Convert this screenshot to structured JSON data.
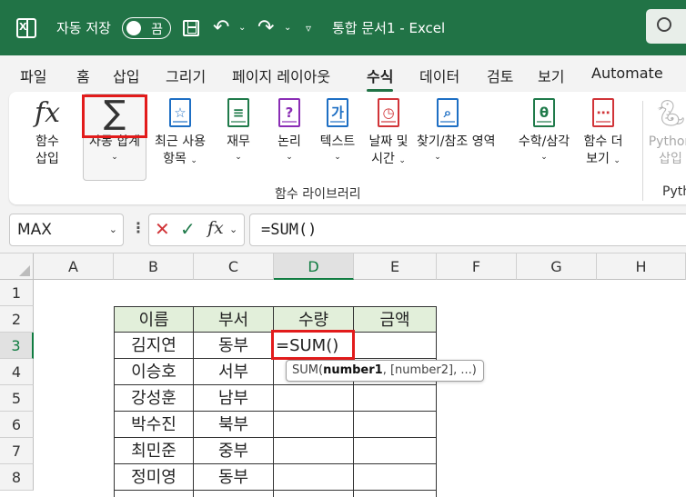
{
  "titlebar": {
    "autosave_label": "자동 저장",
    "autosave_state": "끔",
    "doc_title": "통합 문서1  -  Excel"
  },
  "tabs": [
    "파일",
    "홈",
    "삽입",
    "그리기",
    "페이지 레이아웃",
    "수식",
    "데이터",
    "검토",
    "보기",
    "Automate"
  ],
  "active_tab": "수식",
  "ribbon": {
    "insert_function": [
      "함수",
      "삽입"
    ],
    "autosum": "자동 합계",
    "recent": [
      "최근 사용",
      "항목"
    ],
    "financial": "재무",
    "logical": "논리",
    "text": "텍스트",
    "datetime": [
      "날짜 및",
      "시간"
    ],
    "lookup": "찾기/참조",
    "area": "영역",
    "math": "수학/삼각",
    "more": [
      "함수 더",
      "보기"
    ],
    "python": [
      "Python",
      "삽입"
    ],
    "group_label": "함수 라이브러리",
    "group_label2": "Pyth",
    "icon_text_text": "가"
  },
  "formula_bar": {
    "name_box": "MAX",
    "formula": "=SUM()"
  },
  "columns": [
    "A",
    "B",
    "C",
    "D",
    "E",
    "F",
    "G",
    "H"
  ],
  "rows": [
    "1",
    "2",
    "3",
    "4",
    "5",
    "6",
    "7",
    "8"
  ],
  "table": {
    "headers": [
      "이름",
      "부서",
      "수량",
      "금액"
    ],
    "rows": [
      [
        "김지연",
        "동부"
      ],
      [
        "이승호",
        "서부"
      ],
      [
        "강성훈",
        "남부"
      ],
      [
        "박수진",
        "북부"
      ],
      [
        "최민준",
        "중부"
      ],
      [
        "정미영",
        "동부"
      ]
    ]
  },
  "active_cell_value": "=SUM()",
  "tooltip": {
    "fn": "SUM(",
    "arg1": "number1",
    "rest": ", [number2], ...)"
  },
  "colors": {
    "brand": "#217346",
    "table_header_fill": "#e2efda",
    "highlight_red": "#e21b1b"
  }
}
